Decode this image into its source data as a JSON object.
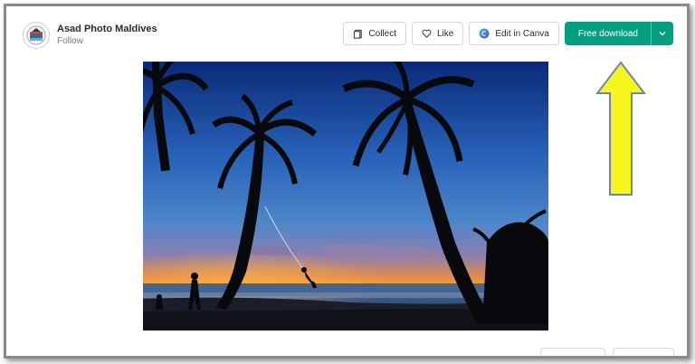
{
  "author": {
    "name": "Asad Photo Maldives",
    "follow_label": "Follow",
    "avatar_icon": "resort-logo-icon"
  },
  "toolbar": {
    "collect_label": "Collect",
    "like_label": "Like",
    "edit_label": "Edit in Canva",
    "download_label": "Free download",
    "collect_icon": "bookmark-icon",
    "like_icon": "heart-icon",
    "edit_icon": "canva-logo-icon",
    "caret_icon": "chevron-down-icon"
  },
  "photo": {
    "subject": "palm-trees-sunset-swing-photo"
  },
  "colors": {
    "primary": "#05a081",
    "arrow_fill": "#f7f51e",
    "arrow_stroke": "#6f86a8"
  }
}
